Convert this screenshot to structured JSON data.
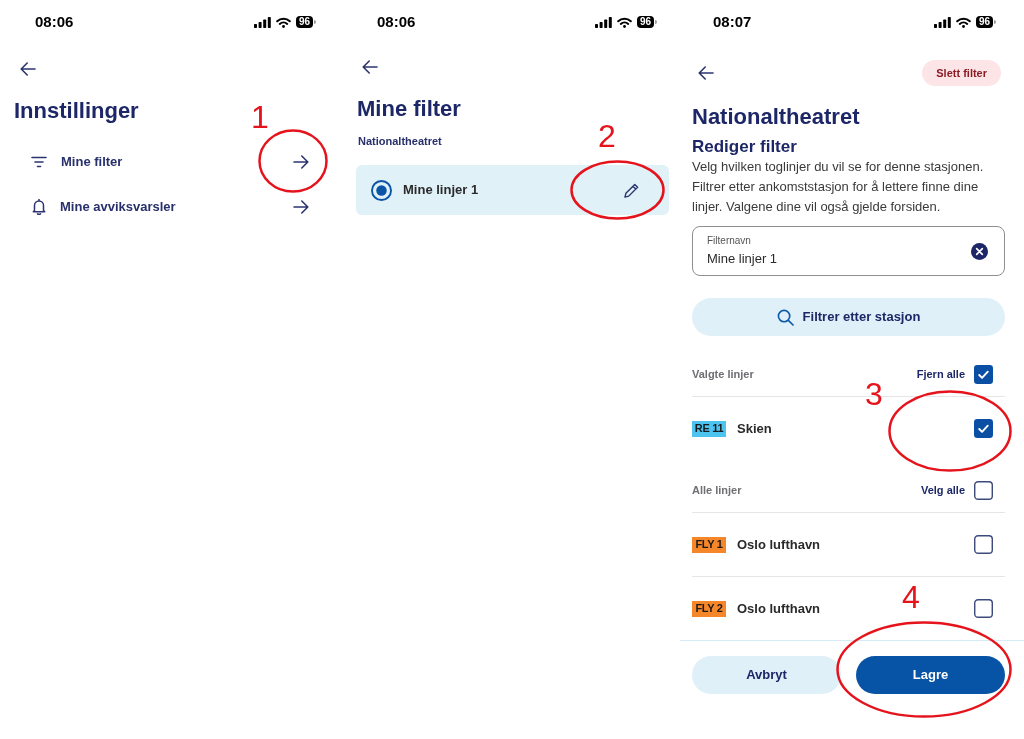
{
  "settings_screen": {
    "status_bar": {
      "time": "08:06",
      "battery": "96"
    },
    "title": "Innstillinger",
    "menu_items": [
      {
        "label": "Mine filter"
      },
      {
        "label": "Mine avviksvarsler"
      }
    ],
    "annotations": [
      {
        "number": "1"
      }
    ]
  },
  "filters_screen": {
    "status_bar": {
      "time": "08:06",
      "battery": "96"
    },
    "title": "Mine filter",
    "station": "Nationaltheatret",
    "filters": [
      {
        "name": "Mine linjer 1",
        "selected": true
      }
    ],
    "annotations": [
      {
        "number": "2"
      }
    ]
  },
  "edit_filter_screen": {
    "status_bar": {
      "time": "08:07",
      "battery": "96"
    },
    "delete_button": "Slett filter",
    "title": "Nationaltheatret",
    "subtitle": "Rediger filter",
    "description": "Velg hvilken toglinjer du vil se for denne stasjonen. Filtrer etter ankomststasjon for å lettere finne dine linjer. Valgene dine vil også gjelde forsiden.",
    "name_field": {
      "label": "Filternavn",
      "value": "Mine linjer 1"
    },
    "search_button": "Filtrer etter stasjon",
    "sections": [
      {
        "heading": "Valgte linjer",
        "action": "Fjern alle",
        "checked": true,
        "lines": [
          {
            "line": "RE 11",
            "color": "#4dc3f0",
            "destination": "Skien",
            "checked": true
          }
        ]
      },
      {
        "heading": "Alle linjer",
        "action": "Velg alle",
        "checked": false,
        "lines": [
          {
            "line": "FLY 1",
            "color": "#f5862a",
            "destination": "Oslo lufthavn",
            "checked": false
          },
          {
            "line": "FLY 2",
            "color": "#f5862a",
            "destination": "Oslo lufthavn",
            "checked": false
          }
        ]
      }
    ],
    "footer_buttons": [
      {
        "label": "Avbryt",
        "kind": "secondary"
      },
      {
        "label": "Lagre",
        "kind": "primary"
      }
    ],
    "annotations": [
      {
        "number": "3"
      },
      {
        "number": "4"
      }
    ]
  }
}
